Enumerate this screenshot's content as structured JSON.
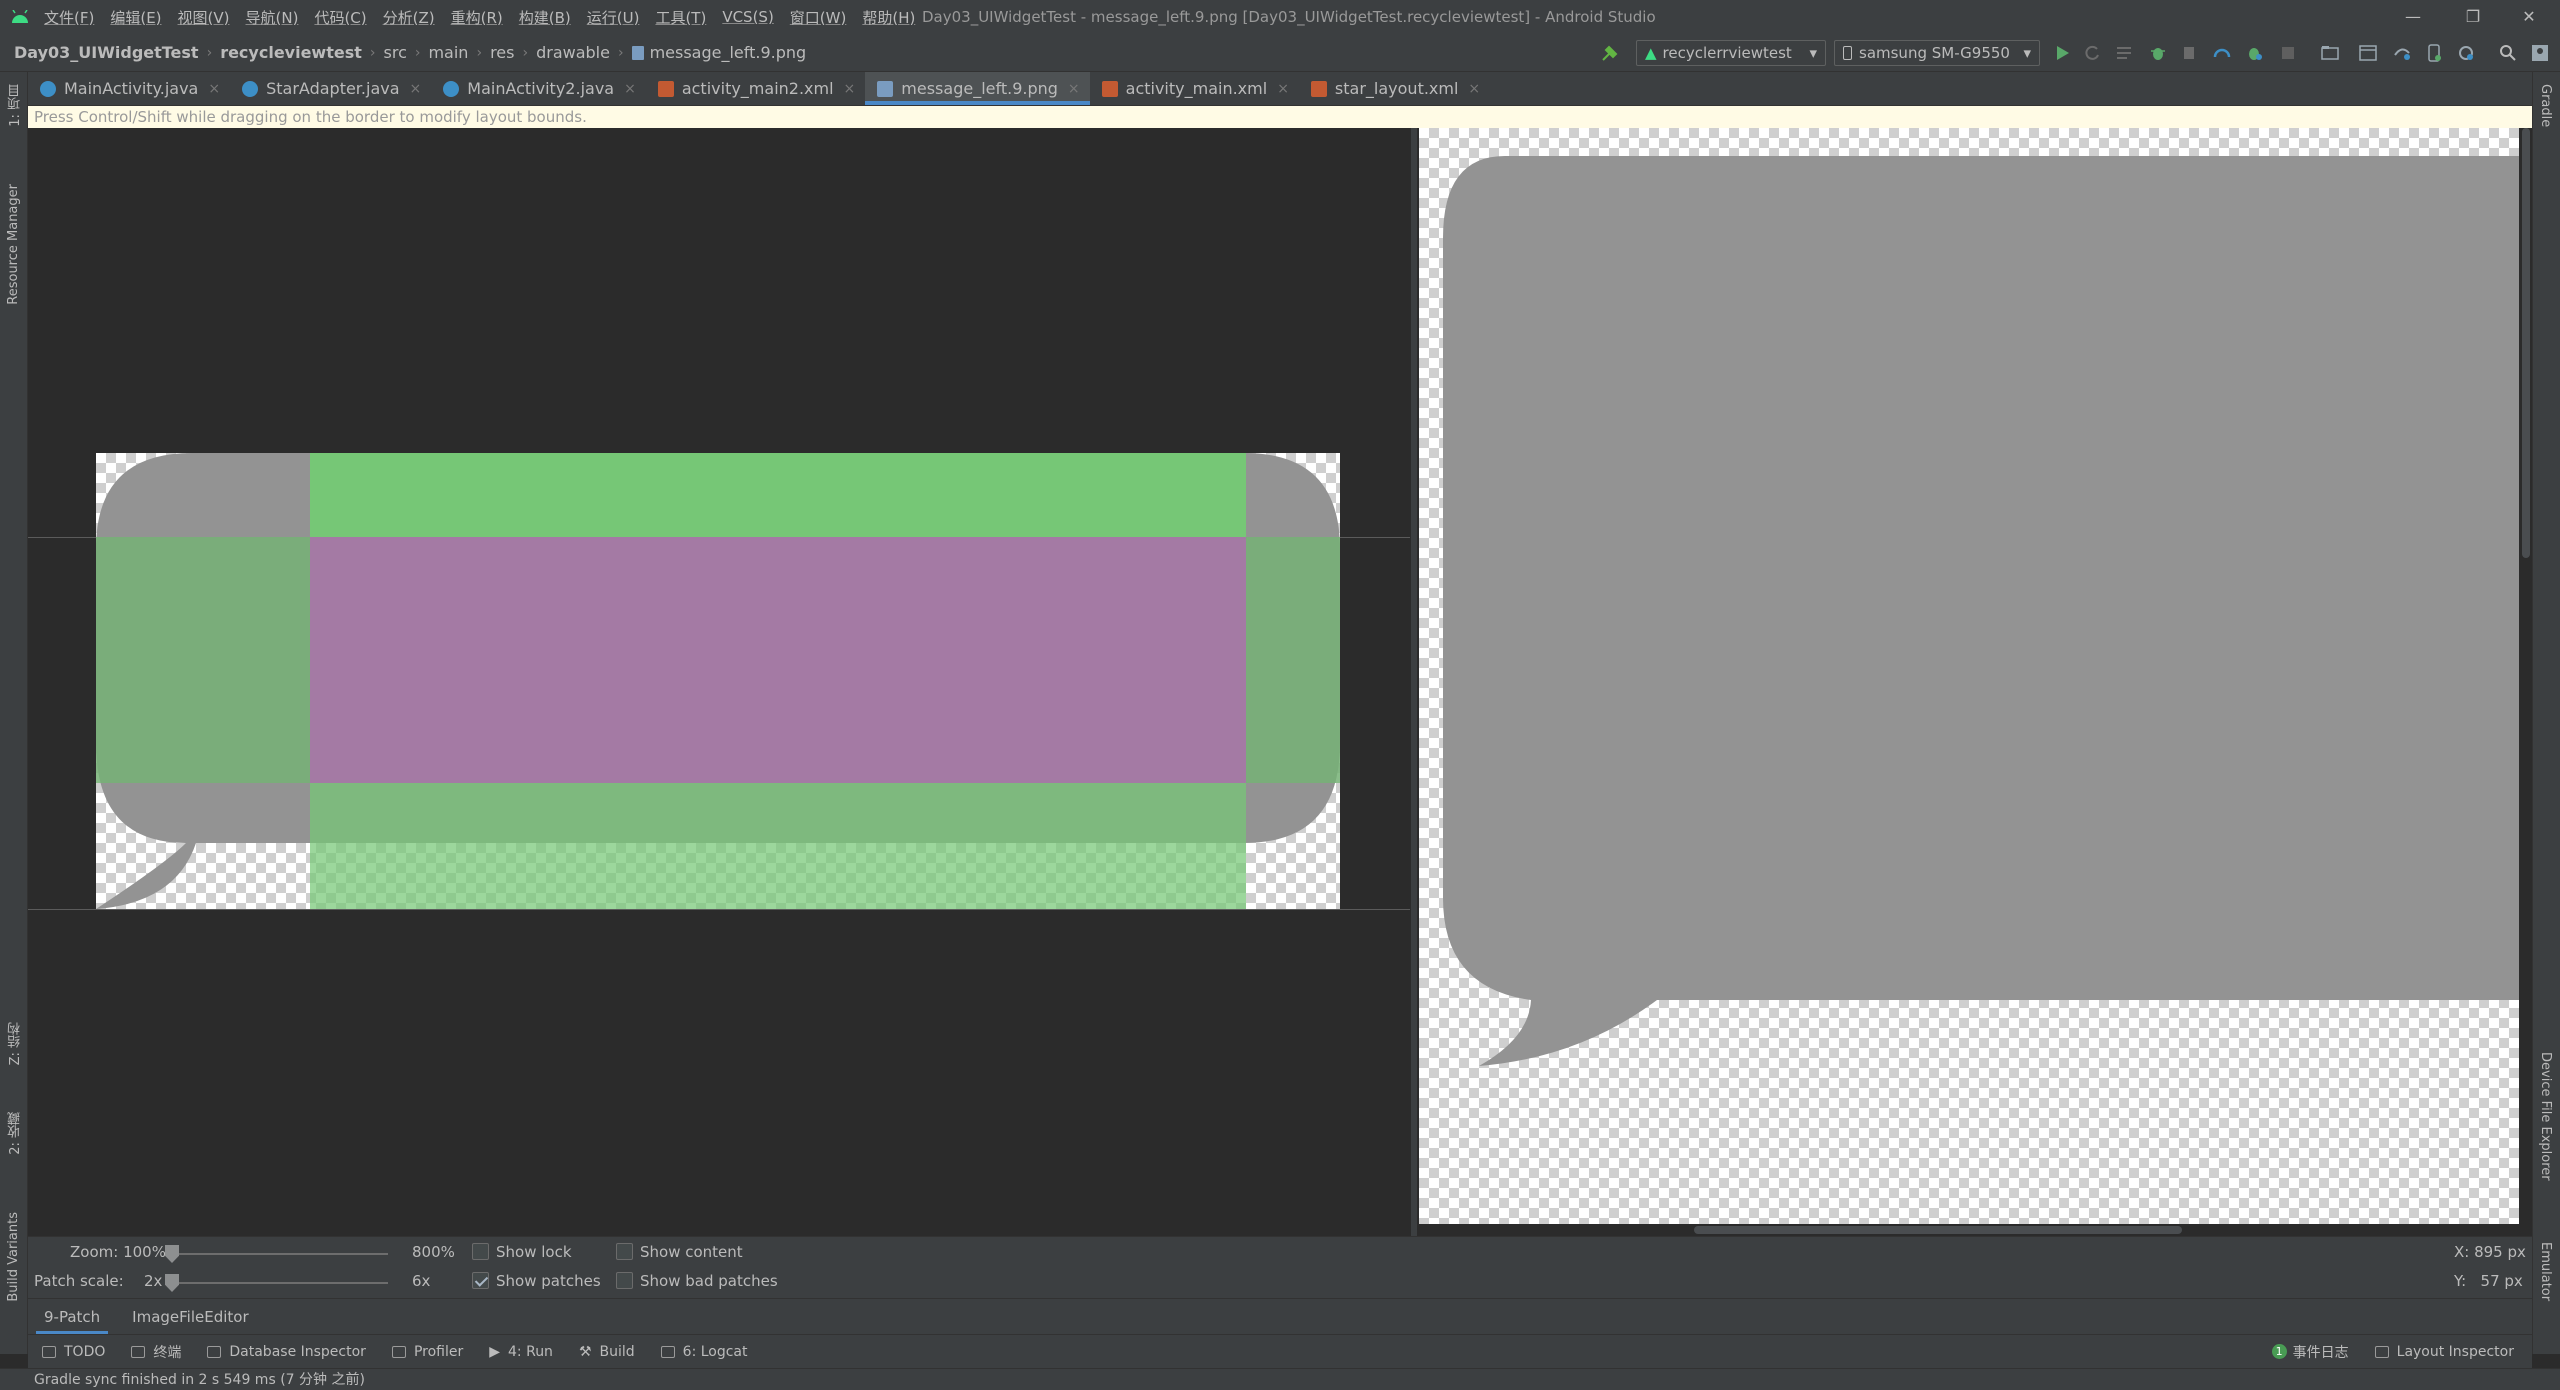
{
  "window": {
    "title": "Day03_UIWidgetTest - message_left.9.png [Day03_UIWidgetTest.recycleviewtest] - Android Studio"
  },
  "menu": [
    "文件(F)",
    "编辑(E)",
    "视图(V)",
    "导航(N)",
    "代码(C)",
    "分析(Z)",
    "重构(R)",
    "构建(B)",
    "运行(U)",
    "工具(T)",
    "VCS(S)",
    "窗口(W)",
    "帮助(H)"
  ],
  "breadcrumb": [
    "Day03_UIWidgetTest",
    "recycleviewtest",
    "src",
    "main",
    "res",
    "drawable",
    "message_left.9.png"
  ],
  "toolbar": {
    "run_config": "recyclerrviewtest",
    "device": "samsung SM-G9550"
  },
  "tabs": [
    {
      "label": "MainActivity.java",
      "type": "java"
    },
    {
      "label": "StarAdapter.java",
      "type": "java"
    },
    {
      "label": "MainActivity2.java",
      "type": "java"
    },
    {
      "label": "activity_main2.xml",
      "type": "xml"
    },
    {
      "label": "message_left.9.png",
      "type": "png",
      "active": true
    },
    {
      "label": "activity_main.xml",
      "type": "xml"
    },
    {
      "label": "star_layout.xml",
      "type": "xml"
    }
  ],
  "hint": "Press Control/Shift while dragging on the border to modify layout bounds.",
  "left_strip": {
    "project": "1: 项目",
    "resource_manager": "Resource Manager",
    "structure": "Z: 结构",
    "favorites": "2: 收藏",
    "build_variants": "Build Variants"
  },
  "right_strip": {
    "gradle": "Gradle",
    "device_file_explorer": "Device File Explorer",
    "emulator": "Emulator"
  },
  "controls": {
    "zoom_label": "Zoom: 100%",
    "zoom_max": "800%",
    "zoom_level": 0.0,
    "patch_scale_label": "Patch scale:",
    "patch_min": "2x",
    "patch_max": "6x",
    "patch_level": 0.0,
    "show_lock": {
      "label": "Show lock",
      "checked": false
    },
    "show_content": {
      "label": "Show content",
      "checked": false
    },
    "show_patches": {
      "label": "Show patches",
      "checked": true
    },
    "show_bad_patches": {
      "label": "Show bad patches",
      "checked": false
    },
    "coord_x": "X: 895 px",
    "coord_y": "Y:   57 px"
  },
  "sub_tabs": [
    "9-Patch",
    "ImageFileEditor"
  ],
  "tool_windows": [
    "TODO",
    "终端",
    "Database Inspector",
    "Profiler",
    "4: Run",
    "Build",
    "6: Logcat"
  ],
  "tool_windows_right": [
    "事件日志",
    "Layout Inspector"
  ],
  "event_count": "1",
  "status": "Gradle sync finished in 2 s 549 ms (7 分钟 之前)",
  "colors": {
    "bubble": "#939393",
    "patch_green": "#76c776",
    "patch_purple": "#a47aa4",
    "accent": "#4a88c7"
  }
}
